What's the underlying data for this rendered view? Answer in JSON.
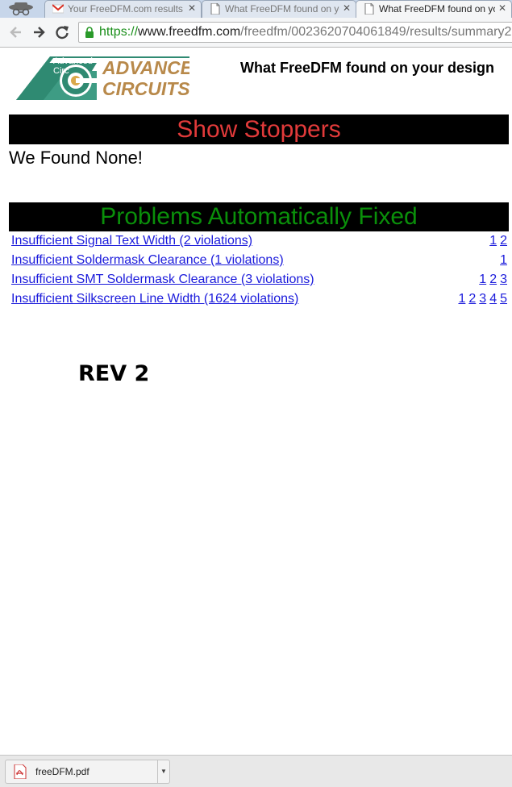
{
  "browser": {
    "tabs": [
      {
        "title": "Your FreeDFM.com results",
        "icon": "gmail-icon",
        "active": false
      },
      {
        "title": "What FreeDFM found on your design",
        "icon": "page-icon",
        "active": false
      },
      {
        "title": "What FreeDFM found on your design",
        "icon": "page-icon",
        "active": true
      }
    ],
    "url": {
      "scheme": "https://",
      "host": "www.freedfm.com",
      "path": "/freedfm/0023620704061849/results/summary2"
    }
  },
  "header": {
    "title": "What FreeDFM found on your design",
    "logo_text_line1": "ADVANCED",
    "logo_text_line2": "CIRCUITS",
    "logo_overlay_line1": "Advanced",
    "logo_overlay_line2": "Circ"
  },
  "show_stoppers": {
    "heading": "Show Stoppers",
    "message": "We Found None!"
  },
  "problems_fixed": {
    "heading": "Problems Automatically Fixed",
    "items": [
      {
        "label": "Insufficient Signal Text Width (2 violations)",
        "p1": "1",
        "p2": "2"
      },
      {
        "label": "Insufficient Soldermask Clearance (1 violations)",
        "p1": "1"
      },
      {
        "label": "Insufficient SMT Soldermask Clearance (3 violations)",
        "p1": "1",
        "p2": "2",
        "p3": "3"
      },
      {
        "label": "Insufficient Silkscreen Line Width (1624 violations)",
        "p1": "1",
        "p2": "2",
        "p3": "3",
        "p4": "4",
        "p5": "5"
      }
    ]
  },
  "annotation": {
    "text": "REV 2"
  },
  "downloads": {
    "file_name": "freeDFM.pdf"
  },
  "colors": {
    "show_stoppers_text": "#e13a3a",
    "fixed_text": "#0a8f0a",
    "link": "#1a1adb",
    "url_secure": "#1b8f1b"
  }
}
